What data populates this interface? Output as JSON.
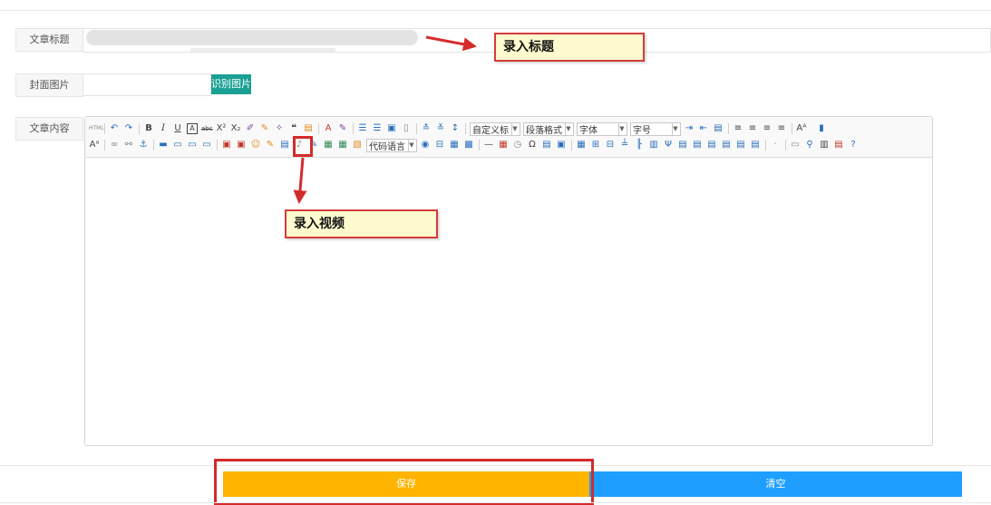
{
  "form": {
    "title_label": "文章标题",
    "cover_label": "封面图片",
    "recognize_button": "识别图片",
    "content_label": "文章内容"
  },
  "toolbar": {
    "dropdowns": {
      "custom_title": "自定义标",
      "paragraph_format": "段落格式",
      "font_family": "字体",
      "font_size": "字号",
      "code_language": "代码语言"
    },
    "row1_icons": [
      "html-icon",
      "undo-icon",
      "redo-icon",
      "bold-icon",
      "italic-icon",
      "underline-icon",
      "font-border-icon",
      "strikethrough-icon",
      "superscript-icon",
      "subscript-icon",
      "remove-format-icon",
      "format-match-icon",
      "auto-typeset-icon",
      "blockquote-icon",
      "paste-plain-icon",
      "font-color-icon",
      "background-color-icon",
      "ordered-list-icon",
      "unordered-list-icon",
      "select-all-icon",
      "clear-doc-icon",
      "row-spacing-top-icon",
      "row-spacing-bottom-icon",
      "line-height-icon"
    ],
    "row2_icons": [
      "font-icon",
      "link-icon",
      "unlink-icon",
      "anchor-icon",
      "image-none-icon",
      "image-left-icon",
      "image-right-icon",
      "image-center-icon",
      "simple-upload-icon",
      "insert-image-icon",
      "emotion-icon",
      "scrawl-icon",
      "insert-video-icon",
      "music-icon",
      "attachment-icon",
      "map-icon",
      "gmap-icon",
      "insert-frame-icon",
      "insert-code-icon",
      "page-break-icon",
      "template-icon",
      "background-icon",
      "horizontal-icon",
      "date-icon",
      "time-icon",
      "special-chars-icon",
      "word-image-icon",
      "search-replace-icon",
      "table-icon",
      "insert-row-icon",
      "delete-row-icon",
      "insert-col-icon",
      "delete-col-icon",
      "merge-cells-icon",
      "split-cells-icon",
      "preview-icon",
      "print-icon",
      "drafts-icon",
      "help-icon"
    ]
  },
  "annotations": {
    "title_note": "录入标题",
    "video_note": "录入视频"
  },
  "actions": {
    "save": "保存",
    "clear": "清空"
  },
  "colors": {
    "recognize_green": "#1aa094",
    "save_orange": "#ffb400",
    "clear_blue": "#1e9fff",
    "annotation_red": "#d42b2b",
    "note_yellow": "#fffbcf"
  }
}
